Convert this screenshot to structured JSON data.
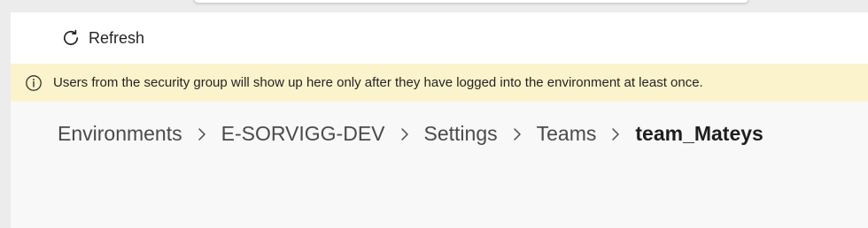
{
  "command_bar": {
    "refresh_label": "Refresh",
    "refresh_icon": "refresh-icon"
  },
  "banner": {
    "icon": "info-icon",
    "message": "Users from the security group will show up here only after they have logged into the environment at least once."
  },
  "breadcrumb": {
    "items": [
      {
        "label": "Environments"
      },
      {
        "label": "E-SORVIGG-DEV"
      },
      {
        "label": "Settings"
      },
      {
        "label": "Teams"
      },
      {
        "label": "team_Mateys"
      }
    ],
    "separator_icon": "chevron-right-icon"
  },
  "colors": {
    "banner_background": "#fbf3cb",
    "page_background": "#f8f8f8",
    "command_bar_background": "#ffffff"
  }
}
